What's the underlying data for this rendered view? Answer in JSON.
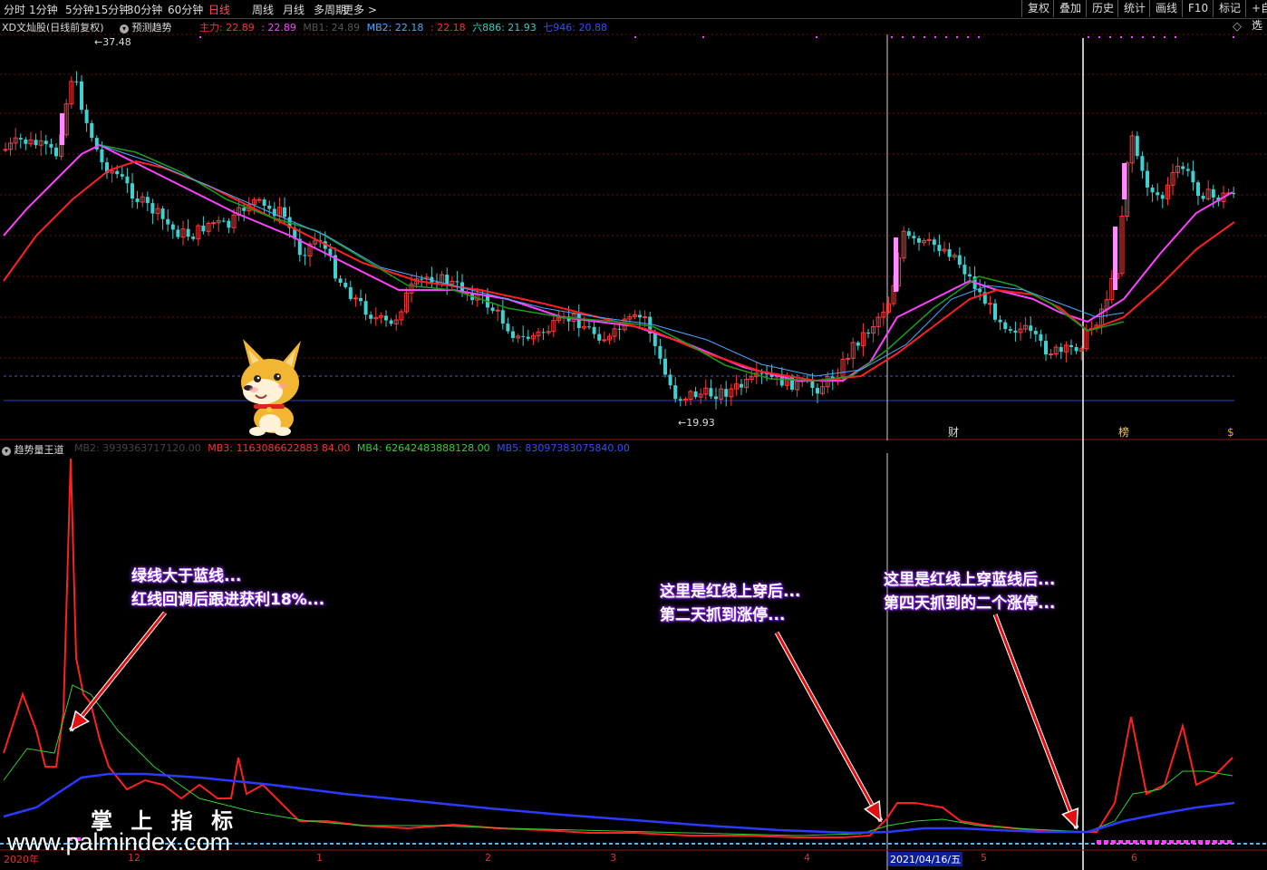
{
  "toolbar": {
    "tabs": [
      "分时",
      "1分钟",
      "5分钟",
      "15分钟",
      "30分钟",
      "60分钟",
      "日线",
      "周线",
      "月线",
      "多周期",
      "更多"
    ],
    "active_tab": "日线",
    "right_buttons": [
      "复权",
      "叠加",
      "历史",
      "统计",
      "画线",
      "F10",
      "标记",
      "+自选"
    ]
  },
  "main_panel": {
    "stock_title": "XD文灿股(日线前复权)",
    "indicator_name": "预测趋势",
    "legend": [
      {
        "label": "主力: 22.89",
        "color": "#ff3030"
      },
      {
        "label": ": 22.89",
        "color": "#ff40ff"
      },
      {
        "label": "MB1: 24.89",
        "color": "#555555"
      },
      {
        "label": "MB2: 22.18",
        "color": "#4aa8ff"
      },
      {
        "label": ": 22.18",
        "color": "#ff3030"
      },
      {
        "label": "六886: 21.93",
        "color": "#30d0c0"
      },
      {
        "label": "七946: 20.88",
        "color": "#3050ff"
      }
    ],
    "high_label": "37.48",
    "low_label": "19.93",
    "markers": [
      "财",
      "榜",
      "$"
    ]
  },
  "sub_panel": {
    "indicator_name": "趋势量王道",
    "legend": [
      {
        "label": "MB2: 3939363717120.00",
        "color": "#444444"
      },
      {
        "label": "MB3: 1163086622883 84.00",
        "color": "#ff3030"
      },
      {
        "label": "MB4: 62642483888128.00",
        "color": "#30d030"
      },
      {
        "label": "MB5: 83097383075840.00",
        "color": "#3050ff"
      }
    ]
  },
  "callouts": [
    {
      "lines": [
        "绿线大于蓝线...",
        "红线回调后跟进获利18%..."
      ]
    },
    {
      "lines": [
        "这里是红线上穿后...",
        "第二天抓到涨停..."
      ]
    },
    {
      "lines": [
        "这里是红线上穿蓝线后...",
        "第四天抓到的二个涨停..."
      ]
    }
  ],
  "watermark": {
    "title": "掌 上 指 标",
    "url": "www.palmindex.com"
  },
  "date_axis": [
    "2020年",
    "12",
    "1",
    "2",
    "3",
    "4",
    "2021/04/16/五",
    "5",
    "6"
  ],
  "colors": {
    "up": "#ff3a3a",
    "down": "#3fd0d0",
    "ma_magenta": "#ff40ff",
    "ma_red": "#ff2020",
    "ma_green": "#1a9a1a",
    "ma_blue": "#4aa8ff"
  }
}
